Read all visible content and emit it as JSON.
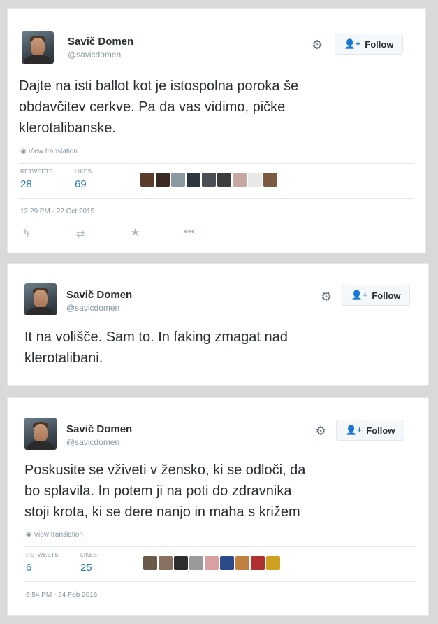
{
  "tweets": [
    {
      "name": "Savič Domen",
      "handle": "@savicdomen",
      "follow_label": "Follow",
      "text": "Dajte na isti ballot kot je istospolna poroka še\nobdavčitev cerkve. Pa da vas vidimo, pičke\nklerotalibanske.",
      "translate": "View translation",
      "retweets_label": "RETWEETS",
      "retweets": "28",
      "likes_label": "LIKES",
      "likes": "69",
      "date": "12:29 PM - 22 Oct 2015",
      "liker_colors": [
        "#5a3b2a",
        "#3a2a22",
        "#8a9aa0",
        "#2f3640",
        "#4b4f55",
        "#3c3c3c",
        "#c7a8a0",
        "#e8e8e8",
        "#7a5a40"
      ]
    },
    {
      "name": "Savič Domen",
      "handle": "@savicdomen",
      "follow_label": "Follow",
      "text": "It na volišče. Sam to. In faking zmagat nad\nklerotalibani."
    },
    {
      "name": "Savič Domen",
      "handle": "@savicdomen",
      "follow_label": "Follow",
      "text": "Poskusite se vživeti v žensko, ki se odloči, da\nbo splavila. In potem ji na poti do zdravnika\nstoji krota, ki se dere nanjo in maha s križem",
      "translate": "View translation",
      "retweets_label": "RETWEETS",
      "retweets": "6",
      "likes_label": "LIKES",
      "likes": "25",
      "date": "6:54 PM - 24 Feb 2016",
      "liker_colors": [
        "#6a5a4a",
        "#8a7060",
        "#2e2e2e",
        "#9a9a9a",
        "#d8a0a0",
        "#2a4a8a",
        "#c08040",
        "#b03030",
        "#d0a020"
      ]
    }
  ],
  "icons": {
    "gear": "gear-icon",
    "follow": "add-person-icon",
    "reply": "reply-icon",
    "retweet": "retweet-icon",
    "like": "star-icon",
    "more": "more-icon"
  },
  "colors": {
    "link": "#2b7bb9",
    "muted": "#8899a6",
    "text": "#292f33"
  }
}
